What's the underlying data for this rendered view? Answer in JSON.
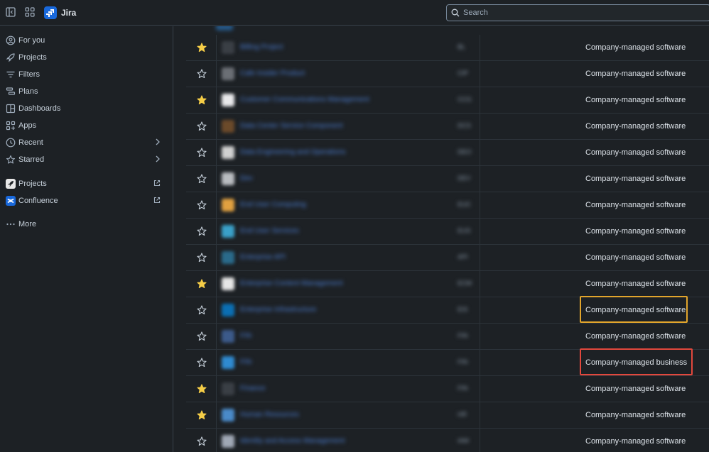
{
  "topbar": {
    "app_name": "Jira",
    "search_placeholder": "Search"
  },
  "sidebar": {
    "items": [
      {
        "label": "For you",
        "icon": "person-circle-icon"
      },
      {
        "label": "Projects",
        "icon": "rocket-icon"
      },
      {
        "label": "Filters",
        "icon": "filter-icon"
      },
      {
        "label": "Plans",
        "icon": "plans-icon"
      },
      {
        "label": "Dashboards",
        "icon": "dashboard-icon"
      },
      {
        "label": "Apps",
        "icon": "apps-icon"
      },
      {
        "label": "Recent",
        "icon": "clock-icon"
      },
      {
        "label": "Starred",
        "icon": "star-icon"
      }
    ],
    "apps": [
      {
        "label": "Projects",
        "icon": "jira-product-icon"
      },
      {
        "label": "Confluence",
        "icon": "confluence-icon"
      }
    ],
    "more_label": "More"
  },
  "projects": [
    {
      "name": "Billing Project",
      "key": "BL",
      "type": "Company-managed software",
      "starred": true
    },
    {
      "name": "Cafe Insider Product",
      "key": "CIP",
      "type": "Company-managed software",
      "starred": false
    },
    {
      "name": "Customer Communications Management",
      "key": "CCG",
      "type": "Company-managed software",
      "starred": true
    },
    {
      "name": "Data Center Service Component",
      "key": "DCS",
      "type": "Company-managed software",
      "starred": false
    },
    {
      "name": "Data Engineering and Operations",
      "key": "DEO",
      "type": "Company-managed software",
      "starred": false
    },
    {
      "name": "Dev",
      "key": "DEV",
      "type": "Company-managed software",
      "starred": false
    },
    {
      "name": "End User Computing",
      "key": "EUC",
      "type": "Company-managed software",
      "starred": false
    },
    {
      "name": "End User Services",
      "key": "EUS",
      "type": "Company-managed software",
      "starred": false
    },
    {
      "name": "Enterprise API",
      "key": "API",
      "type": "Company-managed software",
      "starred": false
    },
    {
      "name": "Enterprise Content Management",
      "key": "ECM",
      "type": "Company-managed software",
      "starred": true
    },
    {
      "name": "Enterprise Infrastructure",
      "key": "EIS",
      "type": "Company-managed software",
      "starred": false
    },
    {
      "name": "FIN",
      "key": "FIN",
      "type": "Company-managed software",
      "starred": false
    },
    {
      "name": "FIN",
      "key": "FIN",
      "type": "Company-managed business",
      "starred": false
    },
    {
      "name": "Finance",
      "key": "FIN",
      "type": "Company-managed software",
      "starred": true
    },
    {
      "name": "Human Resources",
      "key": "HR",
      "type": "Company-managed software",
      "starred": true
    },
    {
      "name": "Identity and Access Management",
      "key": "IAM",
      "type": "Company-managed software",
      "starred": false
    }
  ],
  "colors": {
    "background": "#1d2125",
    "star_filled": "#f5cd47",
    "highlight_yellow": "#e2a52c",
    "highlight_red": "#e2483d",
    "brand": "#1868db"
  }
}
